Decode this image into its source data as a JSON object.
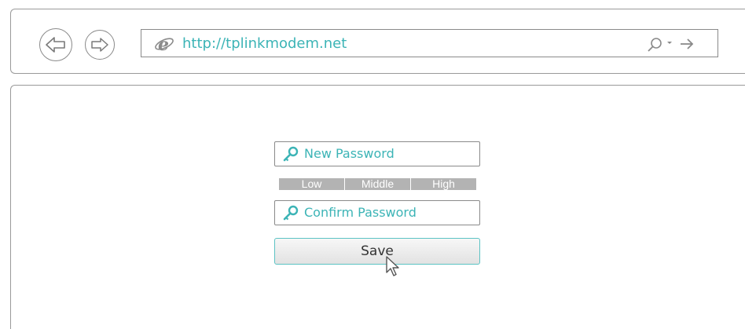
{
  "browser": {
    "url": "http://tplinkmodem.net",
    "icons": {
      "back": "back-arrow-icon",
      "forward": "forward-arrow-icon",
      "browser_logo": "internet-explorer-icon",
      "search": "search-icon",
      "dropdown": "chevron-down-icon",
      "go": "go-arrow-icon"
    }
  },
  "form": {
    "new_password_placeholder": "New Password",
    "confirm_password_placeholder": "Confirm Password",
    "strength_levels": [
      "Low",
      "Middle",
      "High"
    ],
    "save_label": "Save",
    "field_icon": "key-icon"
  },
  "colors": {
    "accent": "#3cb4b6",
    "strength_bar": "#b3b3b3",
    "border": "#8a8a8a"
  }
}
